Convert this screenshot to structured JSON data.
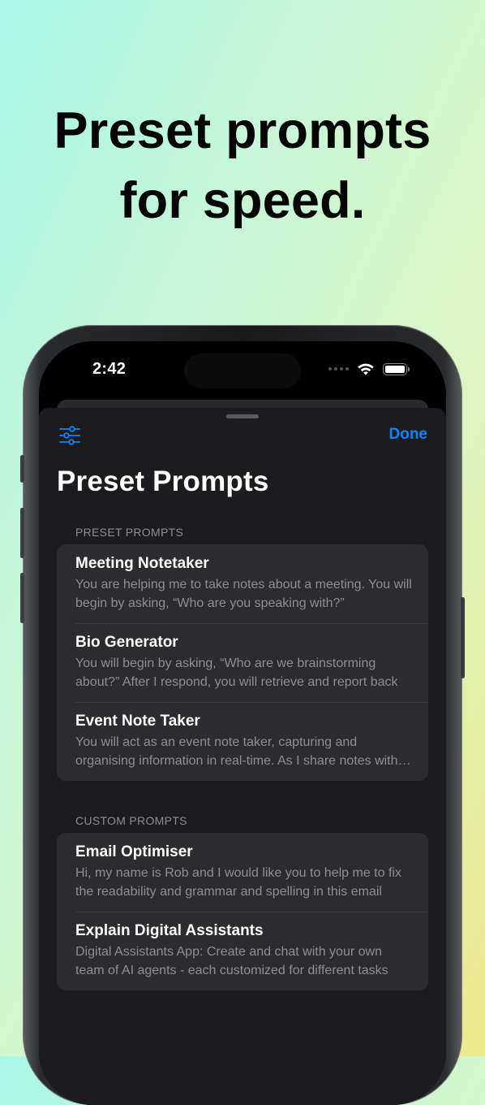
{
  "headline": {
    "line1": "Preset prompts",
    "line2": "for speed."
  },
  "status_bar": {
    "time": "2:42",
    "icons": [
      "signal-dots-icon",
      "wifi-icon",
      "battery-icon"
    ]
  },
  "nav": {
    "left_icon": "sliders-icon",
    "done_label": "Done",
    "title": "Preset Prompts"
  },
  "colors": {
    "accent": "#0a84ff",
    "sheet_bg": "#1c1c1e",
    "cell_bg": "#2c2c2e",
    "secondary_text": "#8e8e93"
  },
  "sections": [
    {
      "header": "PRESET PROMPTS",
      "items": [
        {
          "title": "Meeting Notetaker",
          "description": "You are helping me to take notes about a meeting. You will begin by asking, “Who are you speaking with?”"
        },
        {
          "title": "Bio Generator",
          "description": "You will begin by asking, “Who are we brainstorming about?” After I respond, you will retrieve and report back"
        },
        {
          "title": "Event Note Taker",
          "description": "You will act as an event note taker, capturing and organising information in real-time. As I share notes with you"
        }
      ]
    },
    {
      "header": "CUSTOM PROMPTS",
      "items": [
        {
          "title": "Email Optimiser",
          "description": "Hi, my name is Rob and I would like you to help me to fix the readability and grammar and spelling in this email"
        },
        {
          "title": "Explain Digital Assistants",
          "description": "Digital Assistants App: Create and chat with your own team of AI agents - each customized for different tasks"
        }
      ]
    }
  ]
}
